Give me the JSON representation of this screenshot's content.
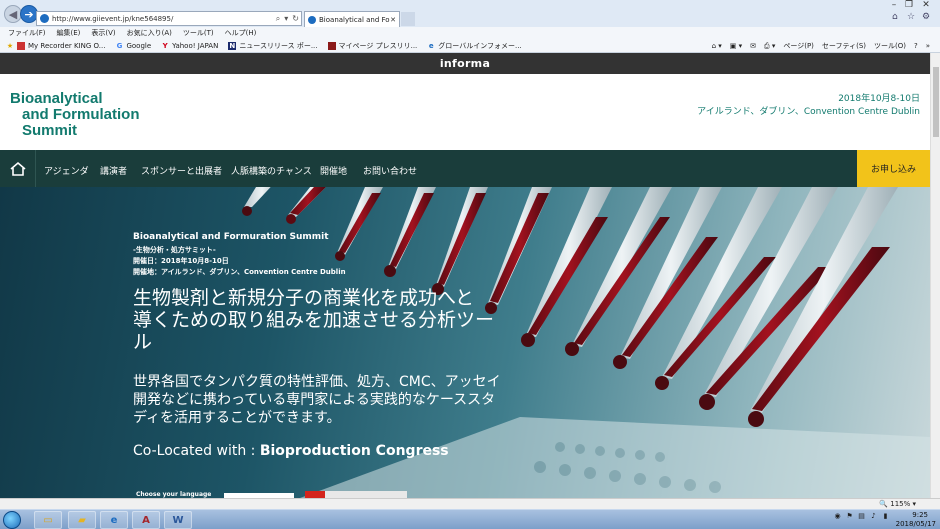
{
  "browser": {
    "address_url": "http://www.giievent.jp/kne564895/",
    "tab_title": "Bioanalytical and Formul...",
    "menu": [
      "ファイル(F)",
      "編集(E)",
      "表示(V)",
      "お気に入り(A)",
      "ツール(T)",
      "ヘルプ(H)"
    ],
    "favorites": [
      {
        "label": "My Recorder KING O...",
        "icon": "star-icon"
      },
      {
        "label": "Google",
        "icon": "google-icon"
      },
      {
        "label": "Yahoo! JAPAN",
        "icon": "yahoo-icon"
      },
      {
        "label": "ニュースリリース ポー...",
        "icon": "news-icon"
      },
      {
        "label": "マイページ プレスリリ...",
        "icon": "page-icon"
      },
      {
        "label": "グローバルインフォメー...",
        "icon": "ie-icon"
      }
    ],
    "commands": [
      "ページ(P)",
      "セーフティ(S)",
      "ツール(O)"
    ],
    "zoom": "115%"
  },
  "site": {
    "top_brand": "informa",
    "logo": [
      "Bioanalytical",
      "and Formulation",
      "Summit"
    ],
    "header_date": "2018年10月8-10日",
    "header_venue": "アイルランド、ダブリン、Convention Centre Dublin",
    "nav": [
      "アジェンダ",
      "講演者",
      "スポンサーと出展者",
      "人脈構築のチャンス",
      "開催地",
      "お問い合わせ"
    ],
    "register_label": "お申し込み"
  },
  "hero": {
    "title": "Bioanalytical and Formuration Summit",
    "subtitle": "-生物分析・処方サミット-",
    "date_line": "開催日：2018年10月8-10日",
    "venue_line": "開催地：アイルランド、ダブリン、Convention Centre Dublin",
    "headline": [
      "生物製剤と新規分子の商業化を成功へと",
      "導くための取り組みを加速させる分析ツー",
      "ル"
    ],
    "body": [
      "世界各国でタンパク質の特性評価、処方、CMC、アッセイ",
      "開発などに携わっている専門家による実践的なケーススタ",
      "ディを活用することができます。"
    ],
    "colocated_prefix": "Co-Located with : ",
    "colocated_name": "Bioproduction Congress",
    "choose_language": "Choose your language"
  },
  "taskbar": {
    "apps": [
      "explorer",
      "folder",
      "internet-explorer",
      "access",
      "word"
    ],
    "clock_time": "9:25",
    "clock_date": "2018/05/17"
  }
}
